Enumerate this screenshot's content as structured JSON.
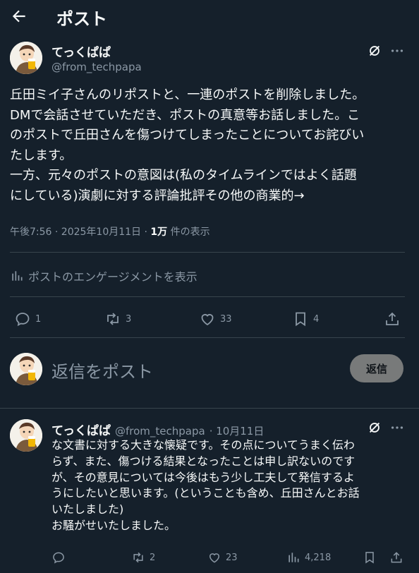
{
  "header": {
    "title": "ポスト"
  },
  "main_post": {
    "author_name": "てっくぱぱ",
    "author_handle": "@from_techpapa",
    "lines": [
      "丘田ミイ子さんのリポストと、一連のポストを削除しました。",
      "DMで会話させていただき、ポストの真意等お話しました。こ",
      "のポストで丘田さんを傷つけてしまったことについてお詫びい",
      "たします。",
      "一方、元々のポストの意図は(私のタイムラインではよく話題",
      "にしている)演劇に対する評論批評その他の商業的→"
    ],
    "timestamp": "午後7:56 · 2025年10月11日 · ",
    "views_count": "1万",
    "views_suffix": " 件の表示",
    "engagement_link": "ポストのエンゲージメントを表示",
    "stats": {
      "replies": "1",
      "reposts": "3",
      "likes": "33",
      "bookmarks": "4"
    }
  },
  "composer": {
    "placeholder": "返信をポスト",
    "reply_button": "返信"
  },
  "reply_post": {
    "author_name": "てっくぱぱ",
    "author_handle": "@from_techpapa",
    "date": "· 10月11日",
    "lines": [
      "な文書に対する大きな懐疑です。その点についてうまく伝わ",
      "らず、また、傷つける結果となったことは申し訳ないのです",
      "が、その意見については今後はもう少し工夫して発信するよ",
      "うにしたいと思います。(ということも含め、丘田さんとお話",
      "いたしました)",
      "お騒がせいたしました。"
    ],
    "stats": {
      "replies": "",
      "reposts": "2",
      "likes": "23",
      "views": "4,218"
    }
  },
  "colors": {
    "background": "#15202b",
    "text": "#f7f9f9",
    "muted": "#8b98a5",
    "divider": "#38444d"
  }
}
